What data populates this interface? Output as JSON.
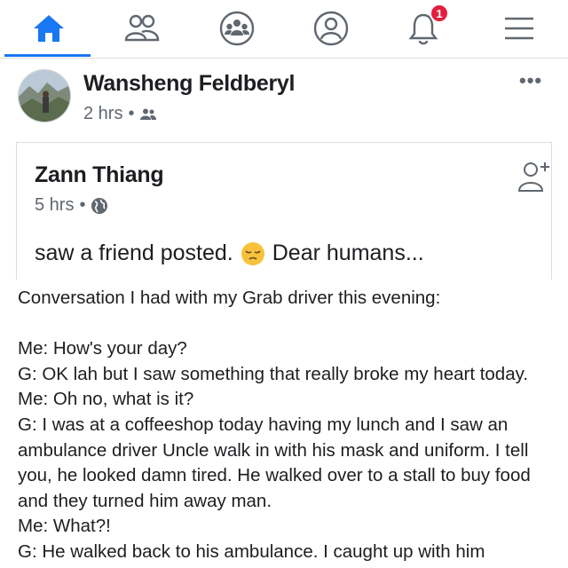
{
  "nav": {
    "items": [
      {
        "name": "home",
        "icon": "home-icon",
        "active": true
      },
      {
        "name": "friends",
        "icon": "friends-icon"
      },
      {
        "name": "groups",
        "icon": "groups-icon"
      },
      {
        "name": "profile",
        "icon": "profile-icon"
      },
      {
        "name": "notifications",
        "icon": "bell-icon",
        "badge": "1"
      },
      {
        "name": "menu",
        "icon": "menu-icon"
      }
    ],
    "accent": "#1877f2",
    "badge_color": "#e41e3f"
  },
  "post": {
    "author": "Wansheng Feldberyl",
    "time": "2 hrs",
    "audience_icon": "friends-audience-icon",
    "more_label": "•••"
  },
  "shared_post": {
    "author": "Zann Thiang",
    "time": "5 hrs",
    "audience_icon": "globe-icon",
    "text_before": "saw a friend posted.",
    "emoji": "pensive-face-emoji",
    "text_after": "Dear humans..."
  },
  "body": {
    "lines": [
      "Conversation I had with my Grab driver this evening:",
      "",
      "Me: How's your day?",
      "G: OK lah but I saw something that really broke my heart today.",
      "Me: Oh no, what is it?",
      "G: I was at a coffeeshop today having my lunch and I saw an ambulance driver Uncle walk in with his mask and uniform. I tell you, he looked damn tired. He walked over to a stall to buy food and they turned him away man.",
      "Me: What?!",
      "G: He walked back to his ambulance. I caught up with him"
    ]
  }
}
